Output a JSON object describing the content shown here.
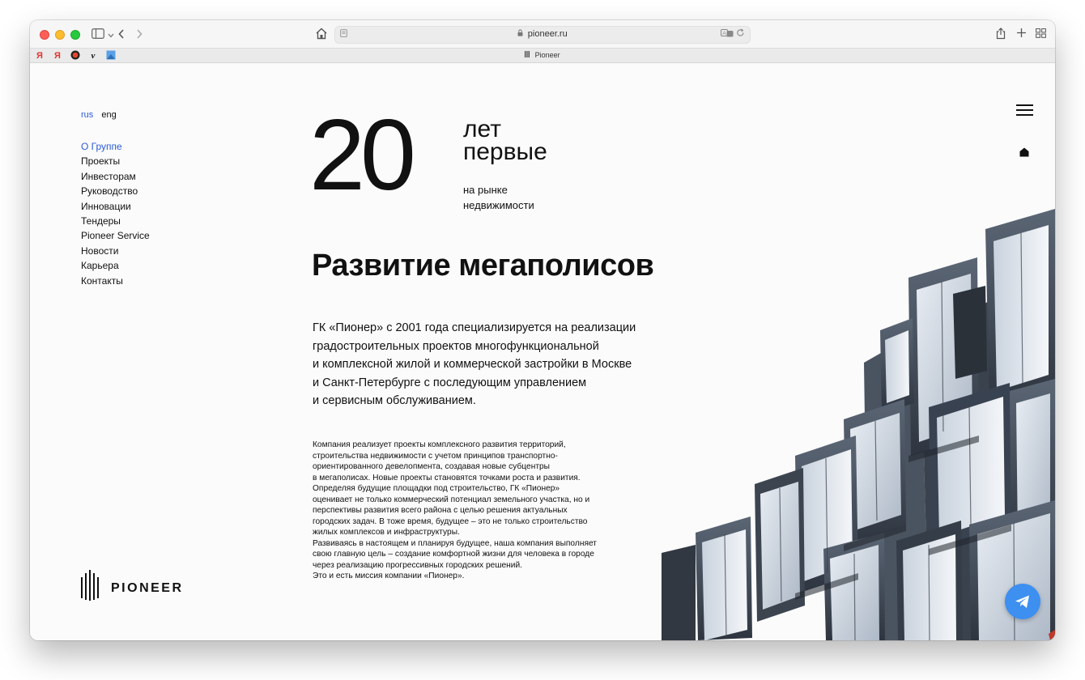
{
  "browser": {
    "url": "pioneer.ru",
    "tab_title": "Pioneer",
    "favorites": [
      "Я",
      "Я",
      "",
      "v",
      ""
    ]
  },
  "lang": {
    "ru": "rus",
    "en": "eng"
  },
  "nav": {
    "items": [
      {
        "label": "О Группе",
        "active": true
      },
      {
        "label": "Проекты"
      },
      {
        "label": "Инвесторам"
      },
      {
        "label": "Руководство"
      },
      {
        "label": "Инновации"
      },
      {
        "label": "Тендеры"
      },
      {
        "label": "Pioneer Service"
      },
      {
        "label": "Новости"
      },
      {
        "label": "Карьера"
      },
      {
        "label": "Контакты"
      }
    ]
  },
  "hero": {
    "number": "20",
    "word1": "лет",
    "word2": "первые",
    "sub1": "на рынке",
    "sub2": "недвижимости"
  },
  "headline": "Развитие мегаполисов",
  "lead": [
    "ГК «Пионер» с 2001 года специализируется на реализации",
    "градостроительных проектов многофункциональной",
    "и комплексной жилой и коммерческой застройки в Москве",
    "и Санкт-Петербурге с последующим управлением",
    "и сервисным обслуживанием."
  ],
  "body": [
    "Компания реализует проекты комплексного развития территорий,",
    "строительства недвижимости с учетом принципов транспортно-",
    "ориентированного девелопмента, создавая новые субцентры",
    "в мегаполисах. Новые проекты становятся точками роста и развития.",
    "Определяя будущие площадки под строительство, ГК «Пионер»",
    "оценивает не только коммерческий потенциал земельного участка, но и",
    "перспективы развития всего района с целью решения актуальных",
    "городских задач. В тоже время, будущее – это не только строительство",
    "жилых комплексов и инфраструктуры.",
    "Развиваясь в настоящем и планируя будущее, наша компания выполняет",
    "свою главную цель – создание комфортной жизни для человека в городе",
    "через реализацию прогрессивных городских решений.",
    "Это и есть миссия компании «Пионер»."
  ],
  "logo": {
    "text": "PIONEER"
  },
  "colors": {
    "accent": "#2b5bd7",
    "telegram": "#3d8ff0",
    "text": "#111111",
    "page_bg": "#fbfbfb"
  },
  "icons": {
    "menu": "hamburger-icon",
    "home": "home-icon",
    "telegram": "telegram-icon"
  }
}
